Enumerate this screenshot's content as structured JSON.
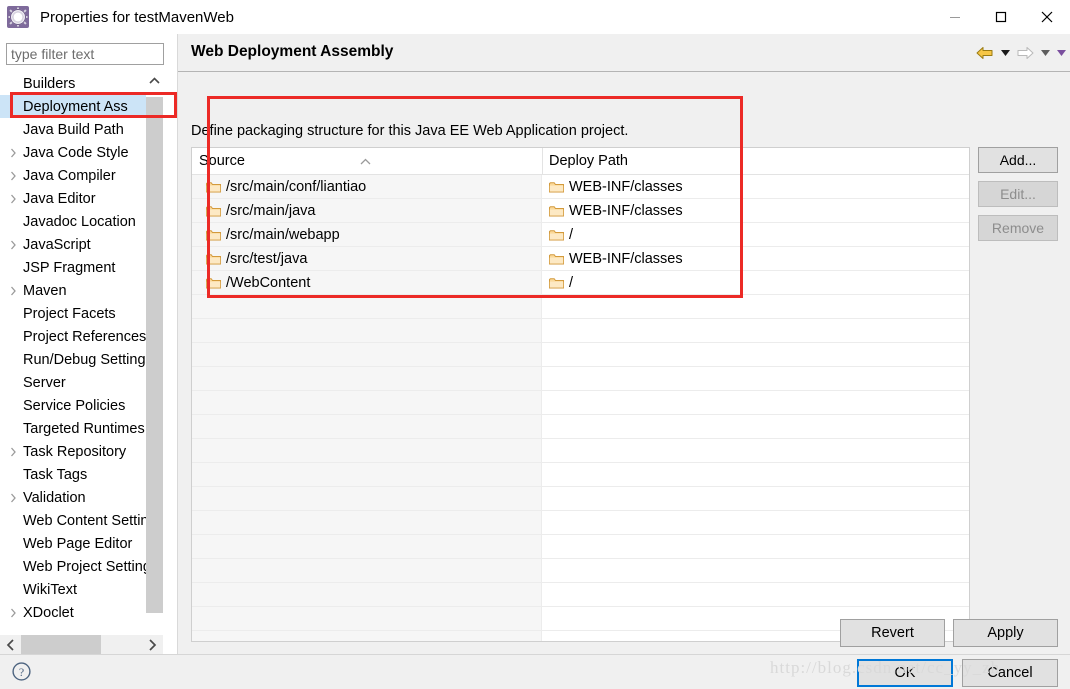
{
  "window": {
    "title": "Properties for testMavenWeb",
    "icon": "properties-gear-icon",
    "controls": {
      "minimize": "minimize-icon",
      "maximize": "maximize-icon",
      "close": "close-icon"
    }
  },
  "sidebar": {
    "filter": {
      "placeholder": "type filter text",
      "value": ""
    },
    "items": [
      {
        "label": "Builders",
        "expandable": false,
        "selected": false
      },
      {
        "label": "Deployment Ass",
        "expandable": false,
        "selected": true
      },
      {
        "label": "Java Build Path",
        "expandable": false,
        "selected": false
      },
      {
        "label": "Java Code Style",
        "expandable": true,
        "selected": false
      },
      {
        "label": "Java Compiler",
        "expandable": true,
        "selected": false
      },
      {
        "label": "Java Editor",
        "expandable": true,
        "selected": false
      },
      {
        "label": "Javadoc Location",
        "expandable": false,
        "selected": false
      },
      {
        "label": "JavaScript",
        "expandable": true,
        "selected": false
      },
      {
        "label": "JSP Fragment",
        "expandable": false,
        "selected": false
      },
      {
        "label": "Maven",
        "expandable": true,
        "selected": false
      },
      {
        "label": "Project Facets",
        "expandable": false,
        "selected": false
      },
      {
        "label": "Project References",
        "expandable": false,
        "selected": false
      },
      {
        "label": "Run/Debug Settings",
        "expandable": false,
        "selected": false
      },
      {
        "label": "Server",
        "expandable": false,
        "selected": false
      },
      {
        "label": "Service Policies",
        "expandable": false,
        "selected": false
      },
      {
        "label": "Targeted Runtimes",
        "expandable": false,
        "selected": false
      },
      {
        "label": "Task Repository",
        "expandable": true,
        "selected": false
      },
      {
        "label": "Task Tags",
        "expandable": false,
        "selected": false
      },
      {
        "label": "Validation",
        "expandable": true,
        "selected": false
      },
      {
        "label": "Web Content Settings",
        "expandable": false,
        "selected": false
      },
      {
        "label": "Web Page Editor",
        "expandable": false,
        "selected": false
      },
      {
        "label": "Web Project Settings",
        "expandable": false,
        "selected": false
      },
      {
        "label": "WikiText",
        "expandable": false,
        "selected": false
      },
      {
        "label": "XDoclet",
        "expandable": true,
        "selected": false
      }
    ]
  },
  "panel": {
    "title": "Web Deployment Assembly",
    "description": "Define packaging structure for this Java EE Web Application project.",
    "nav": {
      "back_icon": "back-arrow-icon",
      "back_menu_icon": "chevron-down-icon",
      "forward_icon": "forward-arrow-icon",
      "forward_menu_icon": "chevron-down-icon"
    },
    "table": {
      "columns": [
        "Source",
        "Deploy Path"
      ],
      "sort_indicator": "sort-ascending-caret",
      "rows": [
        {
          "source": "/src/main/conf/liantiao",
          "deploy": "WEB-INF/classes"
        },
        {
          "source": "/src/main/java",
          "deploy": "WEB-INF/classes"
        },
        {
          "source": "/src/main/webapp",
          "deploy": "/"
        },
        {
          "source": "/src/test/java",
          "deploy": "WEB-INF/classes"
        },
        {
          "source": "/WebContent",
          "deploy": "/"
        }
      ],
      "empty_row_count": 15,
      "folder_icon": "folder-icon"
    },
    "side_buttons": [
      {
        "label": "Add...",
        "enabled": true
      },
      {
        "label": "Edit...",
        "enabled": false
      },
      {
        "label": "Remove",
        "enabled": false
      }
    ],
    "bottom_buttons": [
      {
        "label": "Revert"
      },
      {
        "label": "Apply"
      }
    ]
  },
  "footer": {
    "help_icon": "help-question-icon",
    "buttons": [
      {
        "label": "OK",
        "default": true
      },
      {
        "label": "Cancel",
        "default": false
      }
    ]
  },
  "watermark": {
    "text": "http://blog.csdn.net/cc_yy_zh"
  },
  "colors": {
    "annotation": "#ec2a26",
    "selection": "#cce4f7",
    "default_button_border": "#0078d7",
    "folder": "#f5c16c"
  }
}
